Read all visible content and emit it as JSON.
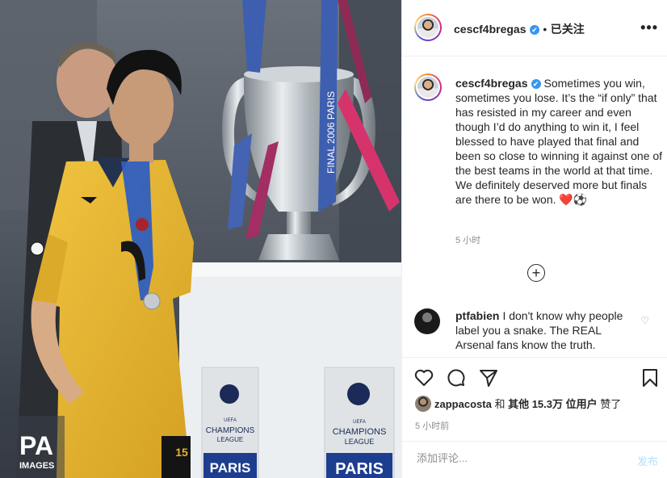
{
  "post": {
    "username": "cescf4bregas",
    "verified_glyph": "✔",
    "separator": "•",
    "follow_status": "已关注",
    "more_label": "•••",
    "caption": "Sometimes you win, sometimes you lose. It’s the “if only” that has resisted in my career and even though I’d do anything to win it, I feel blessed to have played that final and been so close to winning it against one of the best teams in the world at that time. We definitely deserved more but finals are there to be won. ❤️⚽",
    "caption_time": "5 小时",
    "expand_icon": "plus-circle-icon"
  },
  "photo": {
    "watermark_top": "PA",
    "watermark_bottom": "IMAGES",
    "trophy_ribbon_text": "FINAL 2006 PARIS",
    "podium_label_top": "CHAMPIONS",
    "podium_label_bottom": "LEAGUE",
    "podium_city": "PARIS",
    "podium_uefa": "UEFA",
    "shirt_number": "15"
  },
  "comment": {
    "username": "ptfabien",
    "text": "I don't know why people label you a snake. The REAL Arsenal fans know the truth.",
    "like_glyph": "♡"
  },
  "actions": {
    "icons": [
      "heart-icon",
      "comment-icon",
      "share-icon",
      "bookmark-icon"
    ],
    "liked_by_user": "zappacosta",
    "liked_by_connector": "和",
    "liked_by_rest": "其他 15.3万 位用户",
    "liked_by_suffix": "赞了",
    "post_time": "5 小时前"
  },
  "add_comment": {
    "placeholder": "添加评论...",
    "post_label": "发布"
  },
  "colors": {
    "verified": "#3897f0",
    "border": "#efefef",
    "muted": "#8e8e8e",
    "post_button_disabled": "#b2dffc",
    "jersey": "#e4b42f"
  }
}
